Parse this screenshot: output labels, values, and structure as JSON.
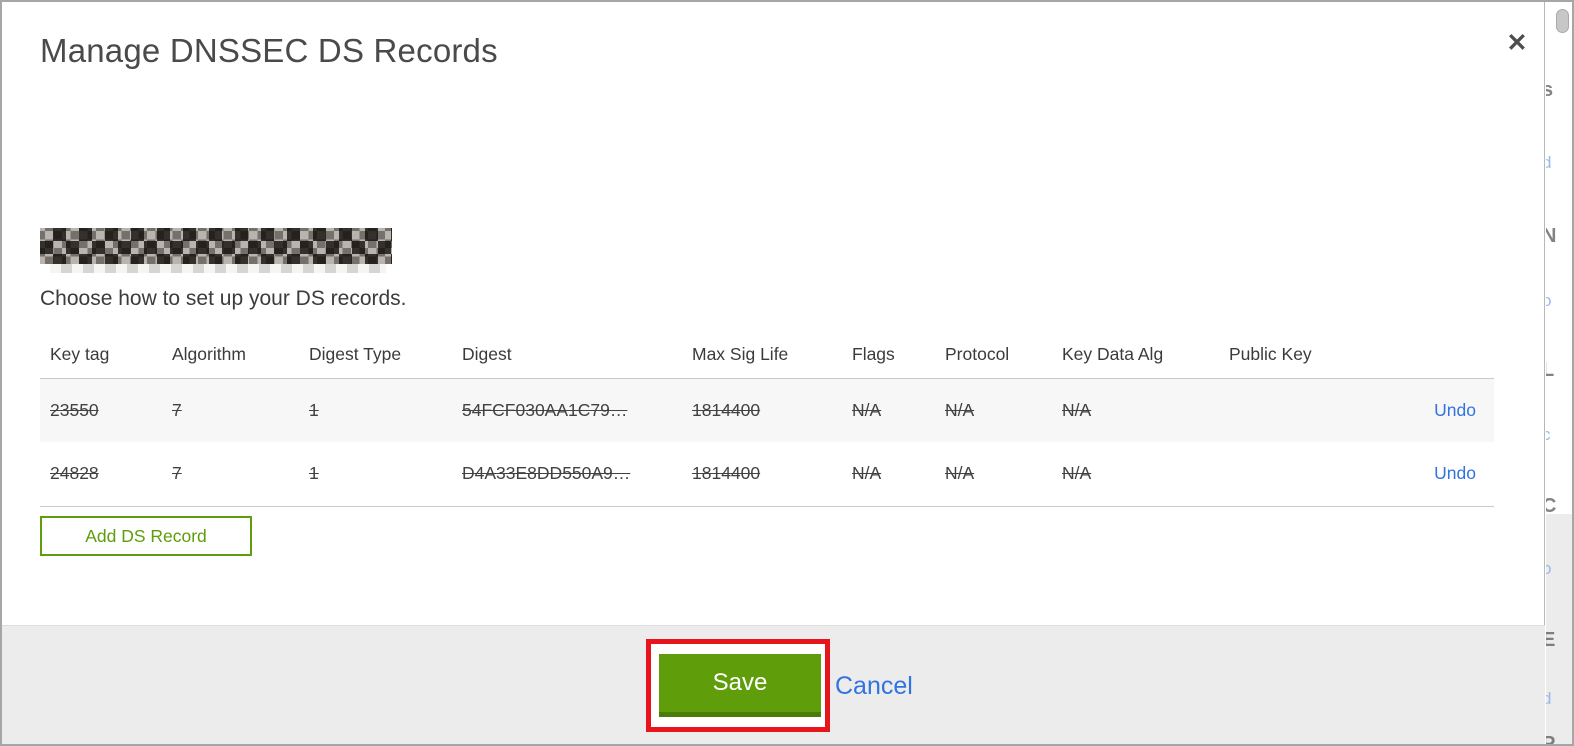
{
  "modal": {
    "title": "Manage DNSSEC DS Records",
    "close_glyph": "✕",
    "domain": {
      "redacted": true
    },
    "instruction": "Choose how to set up your DS records.",
    "table": {
      "headers": [
        "Key tag",
        "Algorithm",
        "Digest Type",
        "Digest",
        "Max Sig Life",
        "Flags",
        "Protocol",
        "Key Data Alg",
        "Public Key"
      ],
      "rows": [
        {
          "key_tag": "23550",
          "algorithm": "7",
          "digest_type": "1",
          "digest": "54FCF030AA1C79…",
          "max_sig_life": "1814400",
          "flags": "N/A",
          "protocol": "N/A",
          "key_data_alg": "N/A",
          "public_key": "",
          "action": "Undo"
        },
        {
          "key_tag": "24828",
          "algorithm": "7",
          "digest_type": "1",
          "digest": "D4A33E8DD550A9…",
          "max_sig_life": "1814400",
          "flags": "N/A",
          "protocol": "N/A",
          "key_data_alg": "N/A",
          "public_key": "",
          "action": "Undo"
        }
      ],
      "row_state": "struck-through (pending deletion)"
    },
    "add_ds_record_button": "Add DS Record",
    "footer": {
      "save_button": "Save",
      "cancel_link": "Cancel"
    }
  },
  "annotation": {
    "type": "red highlight box around Save button"
  },
  "background_page": {
    "fragments": [
      "s",
      "d",
      "N",
      "o",
      "L",
      "c",
      "C",
      "o",
      "E",
      "d",
      "P"
    ]
  },
  "colors": {
    "green": "#5f9d0a",
    "green-dark": "#4b7d06",
    "blue-link": "#3273e0",
    "red-annotation": "#e8141b",
    "row-alt-bg": "#f7f7f7",
    "footer-bg": "#ececec",
    "text-dark": "#3b3b3b",
    "title": "#4a4a4a",
    "border-gray": "#c9c9c9"
  }
}
